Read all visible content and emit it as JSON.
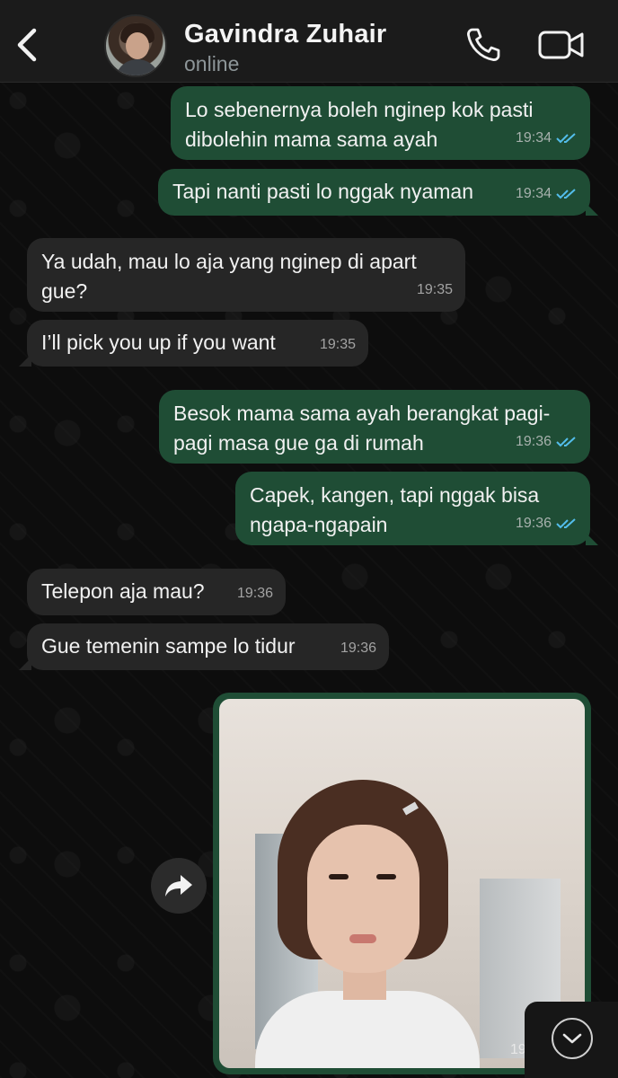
{
  "header": {
    "contact_name": "Gavindra Zuhair",
    "status": "online",
    "icons": [
      "back-chevron-icon",
      "phone-icon",
      "video-camera-icon"
    ]
  },
  "messages": [
    {
      "direction": "out",
      "text": "Lo sebenernya boleh nginep kok pasti dibolehin mama sama ayah",
      "time": "19:34",
      "read": true
    },
    {
      "direction": "out",
      "text": "Tapi nanti pasti lo nggak nyaman",
      "time": "19:34",
      "read": true
    },
    {
      "direction": "in",
      "text": "Ya udah, mau lo aja yang nginep di apart gue?",
      "time": "19:35"
    },
    {
      "direction": "in",
      "text": "I’ll pick you up if you want",
      "time": "19:35"
    },
    {
      "direction": "out",
      "text": "Besok mama sama ayah berangkat pagi-pagi masa gue ga di rumah",
      "time": "19:36",
      "read": true
    },
    {
      "direction": "out",
      "text": "Capek, kangen, tapi nggak bisa ngapa-ngapain",
      "time": "19:36",
      "read": true
    },
    {
      "direction": "in",
      "text": "Telepon aja mau?",
      "time": "19:36"
    },
    {
      "direction": "in",
      "text": "Gue temenin sampe lo tidur",
      "time": "19:36"
    }
  ],
  "image_message": {
    "time_partial": "19"
  },
  "colors": {
    "header_bg": "#1b1b1b",
    "outgoing_bubble": "#1f4d35",
    "incoming_bubble": "#262626",
    "read_ticks": "#53bdeb"
  }
}
